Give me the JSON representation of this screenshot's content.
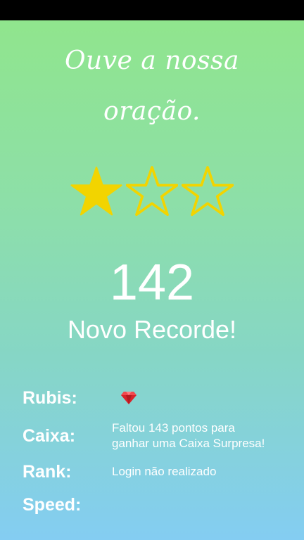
{
  "verse": {
    "line1": "Ouve a nossa",
    "line2": "oração."
  },
  "rating": {
    "filled": 1,
    "total": 3,
    "filled_color": "#f2d400",
    "empty_color": "#f2d400"
  },
  "score": "142",
  "record_label": "Novo Recorde!",
  "stats": {
    "rubis_label": "Rubis:",
    "rubis_icon": "ruby-icon",
    "caixa_label": "Caixa:",
    "caixa_line1": "Faltou 143 pontos para",
    "caixa_line2": "ganhar uma Caixa Surpresa!",
    "rank_label": "Rank:",
    "rank_value": "Login não realizado",
    "speed_label": "Speed:"
  },
  "colors": {
    "gradient_top": "#90e58d",
    "gradient_bottom": "#84cdf2",
    "ruby": "#d8232a"
  }
}
